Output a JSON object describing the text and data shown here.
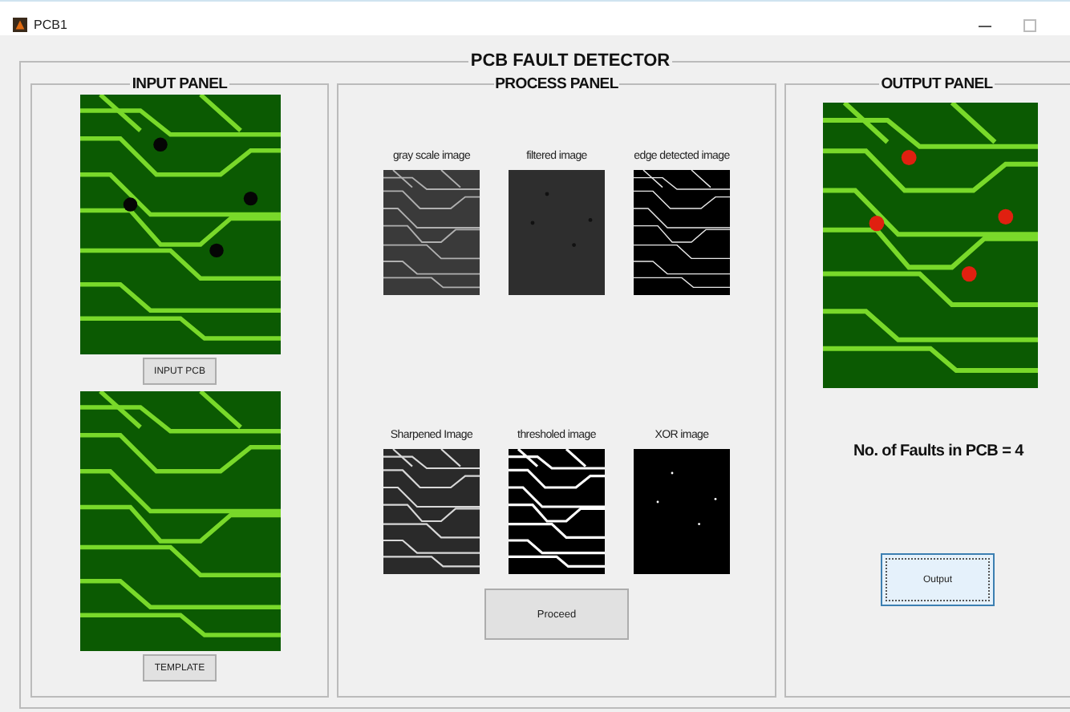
{
  "window": {
    "title": "PCB1"
  },
  "main_title": "PCB  FAULT  DETECTOR",
  "input_panel": {
    "title": "INPUT PANEL",
    "buttons": [
      "INPUT PCB",
      "TEMPLATE"
    ]
  },
  "process_panel": {
    "title": "PROCESS PANEL",
    "images": [
      {
        "label": "gray scale image",
        "kind": "grayscale"
      },
      {
        "label": "filtered image",
        "kind": "filtered"
      },
      {
        "label": "edge detected image",
        "kind": "edges"
      },
      {
        "label": "Sharpened Image",
        "kind": "sharpened"
      },
      {
        "label": "thresholed image",
        "kind": "threshold"
      },
      {
        "label": "XOR image",
        "kind": "xor"
      }
    ],
    "button": "Proceed"
  },
  "output_panel": {
    "title": "OUTPUT PANEL",
    "result": "No. of Faults in PCB = 4",
    "button": "Output"
  }
}
